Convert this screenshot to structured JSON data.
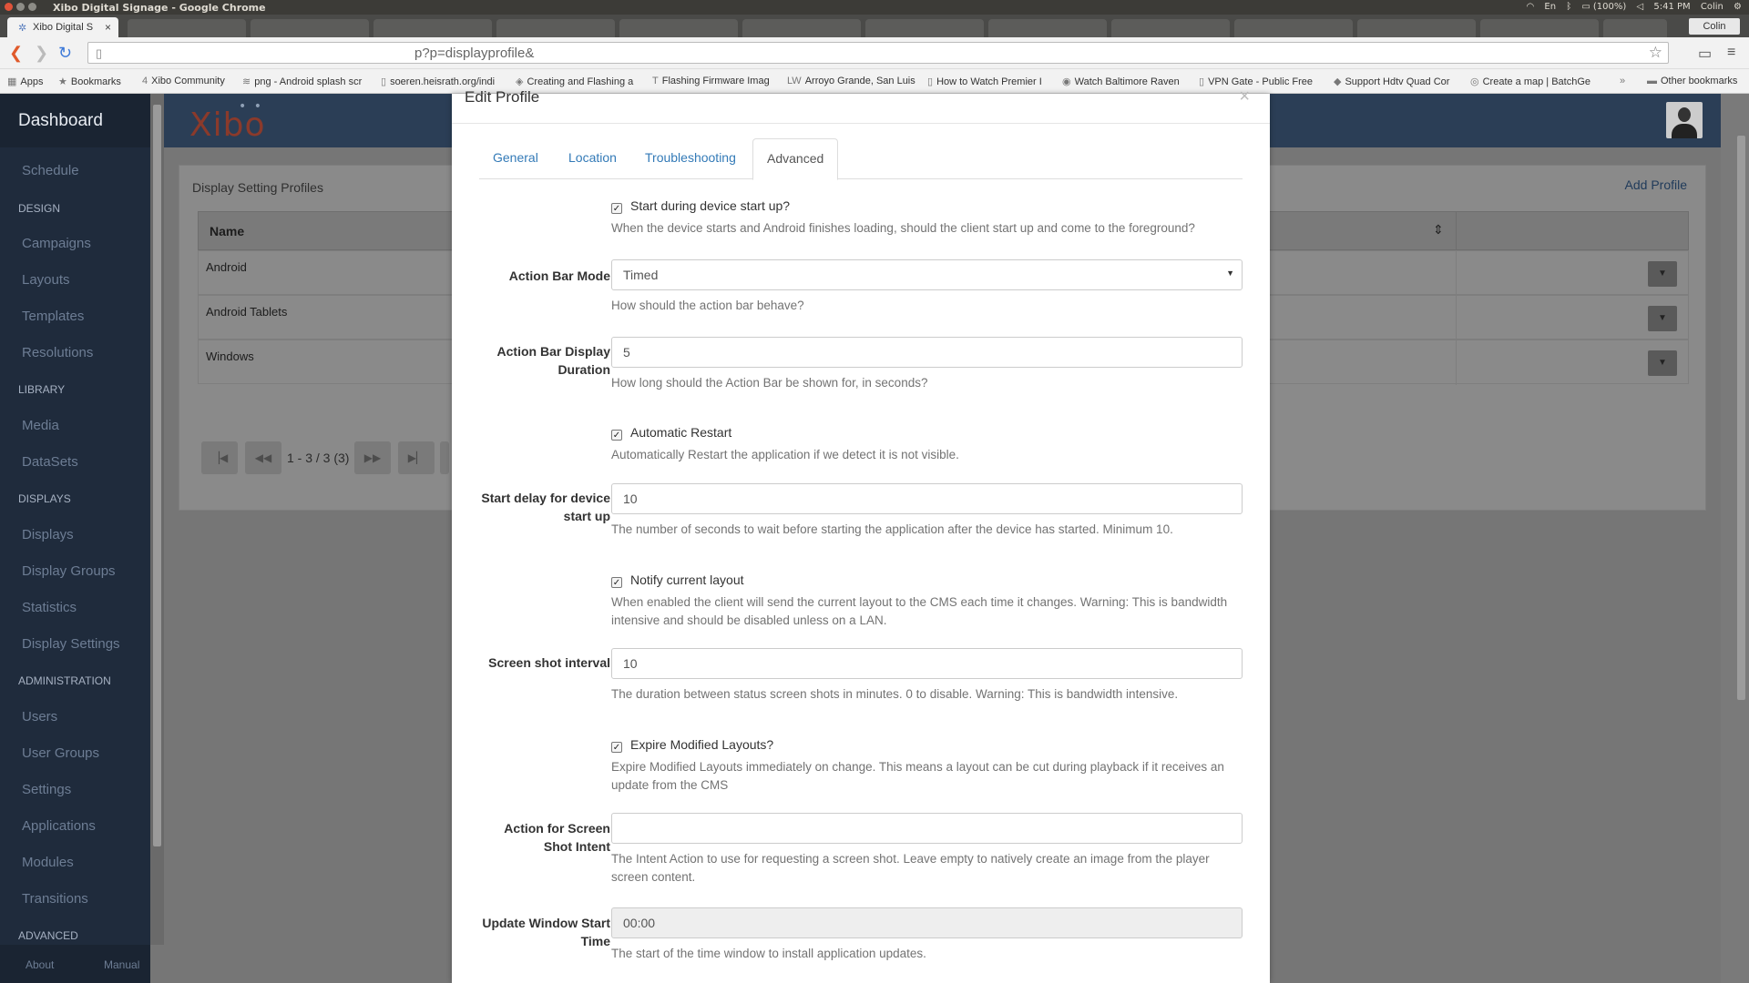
{
  "browser": {
    "window_title": "Xibo Digital Signage - Google Chrome",
    "tray": {
      "lang": "En",
      "battery": "(100%)",
      "time": "5:41 PM",
      "user": "Colin"
    },
    "tab": {
      "title": "Xibo Digital S",
      "close": "×"
    },
    "profile_chip": "Colin",
    "url": "p?p=displayprofile&",
    "bookmarks": [
      {
        "icon": "▦",
        "label": "Apps"
      },
      {
        "icon": "★",
        "label": "Bookmarks"
      },
      {
        "icon": "4",
        "label": "Xibo Community"
      },
      {
        "icon": "≋",
        "label": "png - Android splash scr"
      },
      {
        "icon": "▯",
        "label": "soeren.heisrath.org/indi"
      },
      {
        "icon": "◈",
        "label": "Creating and Flashing a"
      },
      {
        "icon": "T",
        "label": "Flashing Firmware Imag"
      },
      {
        "icon": "LW",
        "label": "Arroyo Grande, San Luis"
      },
      {
        "icon": "▯",
        "label": "How to Watch Premier I"
      },
      {
        "icon": "◉",
        "label": "Watch Baltimore Raven"
      },
      {
        "icon": "▯",
        "label": "VPN Gate - Public Free"
      },
      {
        "icon": "◆",
        "label": "Support Hdtv Quad Cor"
      },
      {
        "icon": "◎",
        "label": "Create a map | BatchGe"
      },
      {
        "icon": "»",
        "label": ""
      },
      {
        "icon": "▬",
        "label": "Other bookmarks"
      }
    ]
  },
  "sidebar": {
    "brand": "Dashboard",
    "items": [
      {
        "type": "item",
        "label": "Schedule"
      },
      {
        "type": "head",
        "label": "DESIGN"
      },
      {
        "type": "item",
        "label": "Campaigns"
      },
      {
        "type": "item",
        "label": "Layouts"
      },
      {
        "type": "item",
        "label": "Templates"
      },
      {
        "type": "item",
        "label": "Resolutions"
      },
      {
        "type": "head",
        "label": "LIBRARY"
      },
      {
        "type": "item",
        "label": "Media"
      },
      {
        "type": "item",
        "label": "DataSets"
      },
      {
        "type": "head",
        "label": "DISPLAYS"
      },
      {
        "type": "item",
        "label": "Displays"
      },
      {
        "type": "item",
        "label": "Display Groups"
      },
      {
        "type": "item",
        "label": "Statistics"
      },
      {
        "type": "item",
        "label": "Display Settings"
      },
      {
        "type": "head",
        "label": "ADMINISTRATION"
      },
      {
        "type": "item",
        "label": "Users"
      },
      {
        "type": "item",
        "label": "User Groups"
      },
      {
        "type": "item",
        "label": "Settings"
      },
      {
        "type": "item",
        "label": "Applications"
      },
      {
        "type": "item",
        "label": "Modules"
      },
      {
        "type": "item",
        "label": "Transitions"
      },
      {
        "type": "head",
        "label": "ADVANCED"
      }
    ],
    "footer": {
      "about": "About",
      "manual": "Manual"
    }
  },
  "header": {
    "logo": "Xibo",
    "logo_dots": "• •"
  },
  "panel": {
    "title": "Display Setting Profiles",
    "add_profile": "Add Profile",
    "column_name": "Name",
    "rows": [
      "Android",
      "Android Tablets",
      "Windows"
    ],
    "pager_info": "1 - 3 / 3 (3)"
  },
  "modal": {
    "title": "Edit Profile",
    "close": "×",
    "tabs": [
      "General",
      "Location",
      "Troubleshooting",
      "Advanced"
    ],
    "fields": {
      "start_on_boot": {
        "label": "Start during device start up?",
        "checked": true,
        "help": "When the device starts and Android finishes loading, should the client start up and come to the foreground?"
      },
      "action_bar_mode": {
        "label": "Action Bar Mode",
        "value": "Timed",
        "help": "How should the action bar behave?"
      },
      "action_bar_duration": {
        "label": "Action Bar Display Duration",
        "value": "5",
        "help": "How long should the Action Bar be shown for, in seconds?"
      },
      "auto_restart": {
        "label": "Automatic Restart",
        "checked": true,
        "help": "Automatically Restart the application if we detect it is not visible."
      },
      "start_delay": {
        "label": "Start delay for device start up",
        "value": "10",
        "help": "The number of seconds to wait before starting the application after the device has started. Minimum 10."
      },
      "notify_layout": {
        "label": "Notify current layout",
        "checked": true,
        "help": "When enabled the client will send the current layout to the CMS each time it changes. Warning: This is bandwidth intensive and should be disabled unless on a LAN."
      },
      "screenshot_interval": {
        "label": "Screen shot interval",
        "value": "10",
        "help": "The duration between status screen shots in minutes. 0 to disable. Warning: This is bandwidth intensive."
      },
      "expire_modified": {
        "label": "Expire Modified Layouts?",
        "checked": true,
        "help": "Expire Modified Layouts immediately on change. This means a layout can be cut during playback if it receives an update from the CMS"
      },
      "screenshot_intent": {
        "label": "Action for Screen Shot Intent",
        "value": "",
        "help": "The Intent Action to use for requesting a screen shot. Leave empty to natively create an image from the player screen content."
      },
      "update_window_start": {
        "label": "Update Window Start Time",
        "value": "00:00",
        "help": "The start of the time window to install application updates."
      }
    }
  }
}
